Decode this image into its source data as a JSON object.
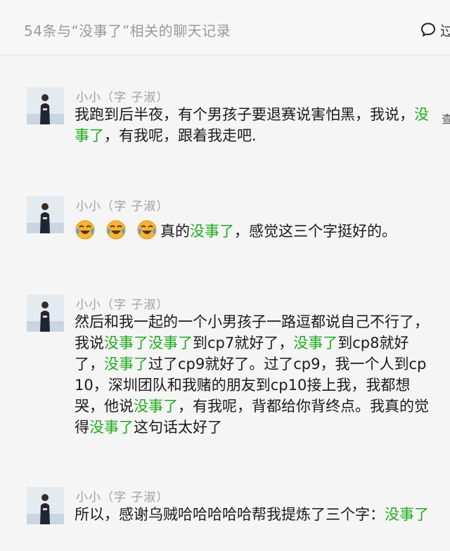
{
  "header": {
    "title": "54条与“没事了”相关的聊天记录",
    "cut_text": "过",
    "icon": "chat-bubble-icon"
  },
  "messages": [
    {
      "sender": "小小（字 子淑）",
      "side_cut": "查",
      "segments": [
        {
          "text": "我跑到后半夜，有个男孩子要退赛说害怕黑，我说，",
          "hl": false
        },
        {
          "text": "没事了",
          "hl": true
        },
        {
          "text": "，有我呢，跟着我走吧.",
          "hl": false
        }
      ]
    },
    {
      "sender": "小小（字 子淑）",
      "emojis": [
        "crying-laughing-emoji",
        "crying-laughing-emoji",
        "crying-laughing-emoji"
      ],
      "segments": [
        {
          "text": "真的",
          "hl": false
        },
        {
          "text": "没事了",
          "hl": true
        },
        {
          "text": "，感觉这三个字挺好的。",
          "hl": false
        }
      ]
    },
    {
      "sender": "小小（字 子淑）",
      "segments": [
        {
          "text": "然后和我一起的一个小男孩子一路逗都说自己不行了，我说",
          "hl": false
        },
        {
          "text": "没事了没事了",
          "hl": true
        },
        {
          "text": "到cp7就好了，",
          "hl": false
        },
        {
          "text": "没事了",
          "hl": true
        },
        {
          "text": "到cp8就好了，",
          "hl": false
        },
        {
          "text": "没事了",
          "hl": true
        },
        {
          "text": "过了cp9就好了。过了cp9，我一个人到cp10，深圳团队和我赌的朋友到cp10接上我，我都想哭，他说",
          "hl": false
        },
        {
          "text": "没事了",
          "hl": true
        },
        {
          "text": "，有我呢，背都给你背终点。我真的觉得",
          "hl": false
        },
        {
          "text": "没事了",
          "hl": true
        },
        {
          "text": "这句话太好了",
          "hl": false
        }
      ]
    },
    {
      "sender": "小小（字 子淑）",
      "segments": [
        {
          "text": "所以，感谢乌贼哈哈哈哈哈帮我提炼了三个字：",
          "hl": false
        },
        {
          "text": "没事了",
          "hl": true
        }
      ]
    }
  ],
  "colors": {
    "highlight": "#1aad19",
    "sender": "#a0a0a0",
    "header_text": "#999999",
    "background": "#f5f5f5"
  }
}
